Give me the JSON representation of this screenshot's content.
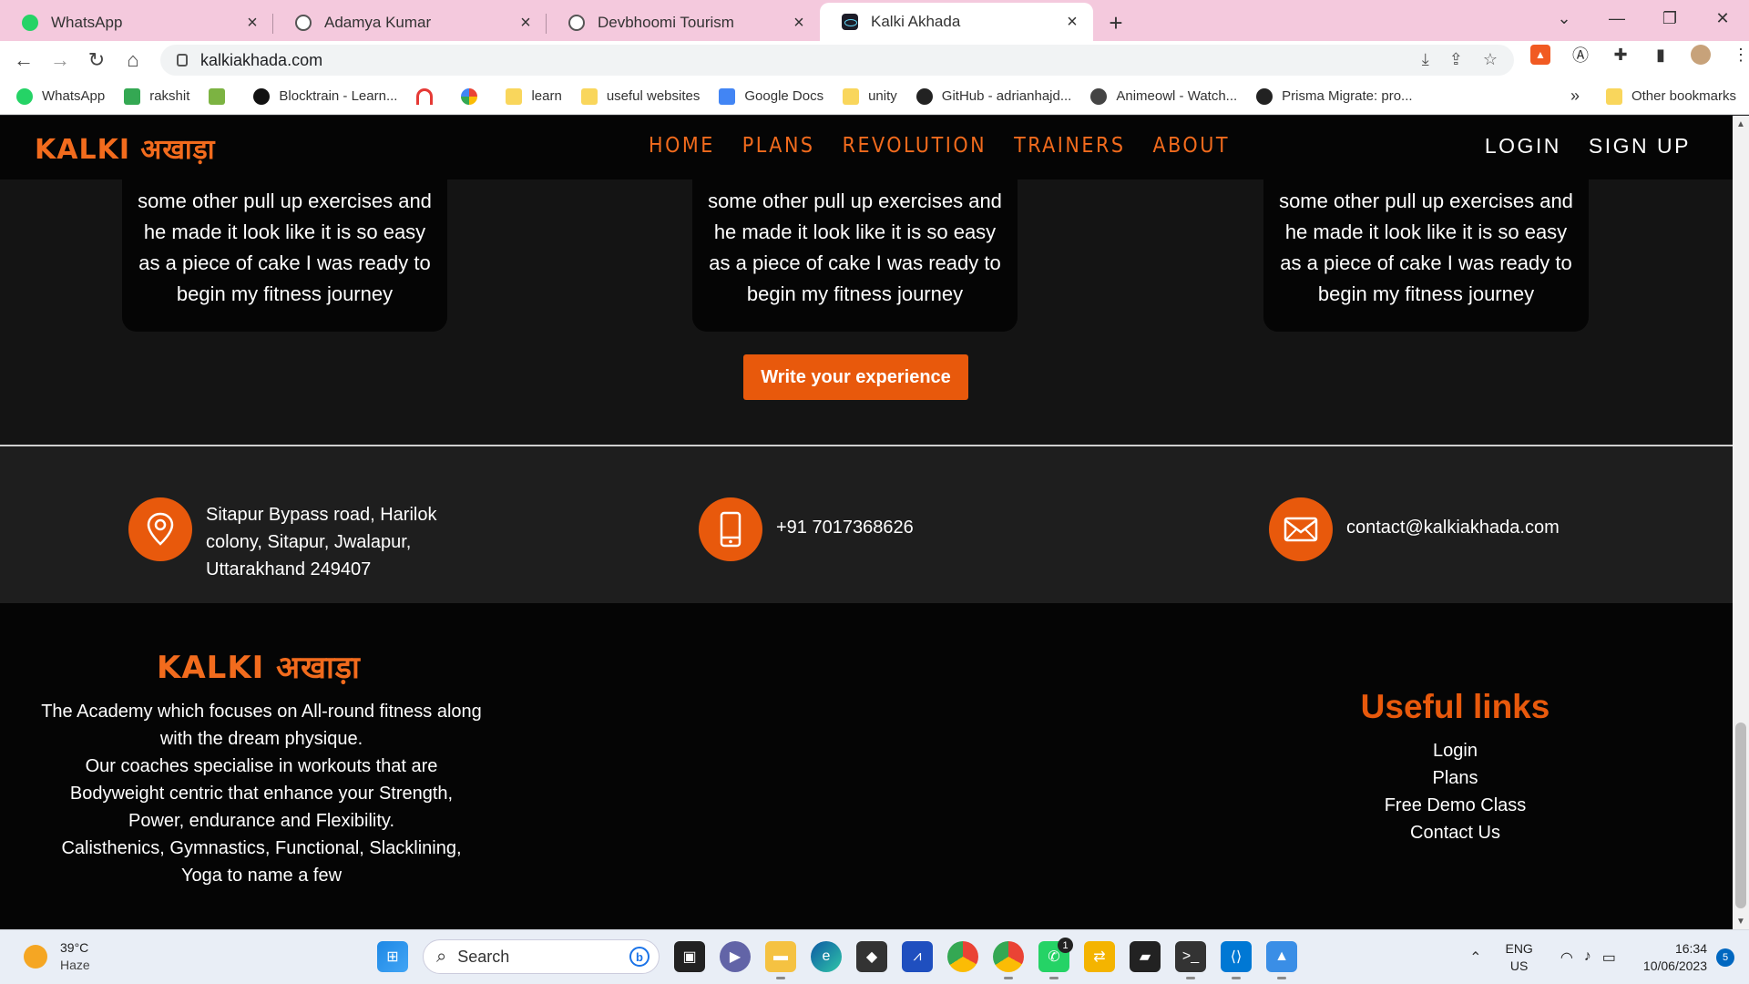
{
  "browser": {
    "tabs": [
      {
        "label": "WhatsApp",
        "icon": "whatsapp-icon"
      },
      {
        "label": "Adamya Kumar",
        "icon": "globe-icon"
      },
      {
        "label": "Devbhoomi Tourism",
        "icon": "globe-icon"
      },
      {
        "label": "Kalki Akhada",
        "icon": "react-icon",
        "active": true
      }
    ],
    "new_tab_glyph": "+",
    "url": "kalkiakhada.com",
    "bookmarks": [
      {
        "label": "WhatsApp",
        "icon": "whatsapp-icon"
      },
      {
        "label": "rakshit",
        "icon": "meet-icon"
      },
      {
        "label": "",
        "icon": "download-arrow-icon"
      },
      {
        "label": "Blocktrain - Learn...",
        "icon": "blocktrain-icon"
      },
      {
        "label": "",
        "icon": "speedometer-icon"
      },
      {
        "label": "",
        "icon": "google-icon"
      },
      {
        "label": "learn",
        "icon": "folder-icon"
      },
      {
        "label": "useful websites",
        "icon": "folder-icon"
      },
      {
        "label": "Google Docs",
        "icon": "google-docs-icon"
      },
      {
        "label": "unity",
        "icon": "folder-icon"
      },
      {
        "label": "GitHub - adrianhajd...",
        "icon": "github-icon"
      },
      {
        "label": "Animeowl - Watch...",
        "icon": "animeowl-icon"
      },
      {
        "label": "Prisma Migrate: pro...",
        "icon": "github-icon"
      }
    ],
    "bookmarks_more": "»",
    "other_bookmarks": "Other bookmarks"
  },
  "site": {
    "logo_text": "KALKI अखाड़ा",
    "nav": [
      "HOME",
      "PLANS",
      "REVOLUTION",
      "TRAINERS",
      "ABOUT"
    ],
    "auth": [
      "LOGIN",
      "SIGN UP"
    ],
    "testimonial_text": "some other pull up exercises and he made it look like it is so easy as a piece of cake I was ready to begin my fitness journey",
    "write_button": "Write your experience",
    "contact": {
      "address": "Sitapur Bypass road, Harilok colony, Sitapur, Jwalapur, Uttarakhand 249407",
      "phone": "+91 7017368626",
      "email": "contact@kalkiakhada.com"
    },
    "footer": {
      "about_lines": [
        "The Academy which focuses on All-round fitness along with the dream physique.",
        "Our coaches specialise in workouts that are Bodyweight centric that enhance your Strength, Power, endurance and Flexibility.",
        "Calisthenics, Gymnastics, Functional, Slacklining, Yoga to name a few"
      ],
      "links_title": "Useful links",
      "links": [
        "Login",
        "Plans",
        "Free Demo Class",
        "Contact Us"
      ]
    },
    "accent_color": "#e8590c"
  },
  "taskbar": {
    "temperature": "39°C",
    "condition": "Haze",
    "search_placeholder": "Search",
    "whatsapp_badge": "1",
    "lang_line1": "ENG",
    "lang_line2": "US",
    "time": "16:34",
    "date": "10/06/2023",
    "notifications": "5"
  }
}
